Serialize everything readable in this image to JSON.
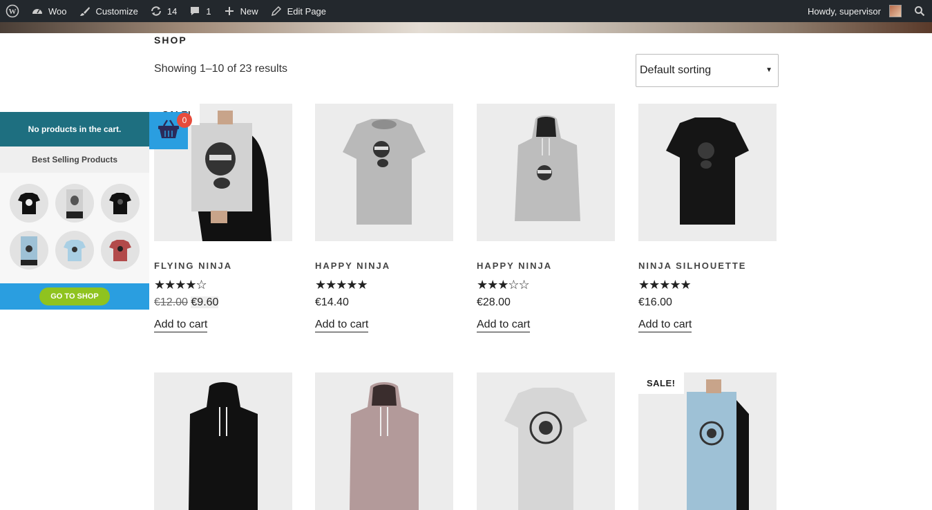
{
  "adminbar": {
    "site_name": "Woo",
    "customize": "Customize",
    "updates": "14",
    "comments": "1",
    "new": "New",
    "edit_page": "Edit Page",
    "howdy": "Howdy, supervisor"
  },
  "shop": {
    "title": "SHOP",
    "result_count": "Showing 1–10 of 23 results",
    "sorting": "Default sorting"
  },
  "side_cart": {
    "empty_text": "No products in the cart.",
    "best_selling": "Best Selling Products",
    "go_to_shop": "GO TO SHOP",
    "count": "0"
  },
  "products": [
    {
      "name": "FLYING NINJA",
      "stars": "★★★★☆",
      "rating": 4,
      "old_price": "€12.00",
      "price": "€9.60",
      "add": "Add to cart",
      "sale": "SALE!"
    },
    {
      "name": "HAPPY NINJA",
      "stars": "★★★★★",
      "rating": 5,
      "price": "€14.40",
      "add": "Add to cart"
    },
    {
      "name": "HAPPY NINJA",
      "stars": "★★★☆☆",
      "rating": 3,
      "price": "€28.00",
      "add": "Add to cart"
    },
    {
      "name": "NINJA SILHOUETTE",
      "stars": "★★★★★",
      "rating": 5,
      "price": "€16.00",
      "add": "Add to cart"
    }
  ],
  "second_row": {
    "sale_badge": "SALE!"
  },
  "colors": {
    "adminbar": "#23282d",
    "cart_header": "#1e6f80",
    "cart_accent": "#2a9ee0",
    "go_shop": "#8fc31f",
    "badge": "#e74c3c"
  }
}
